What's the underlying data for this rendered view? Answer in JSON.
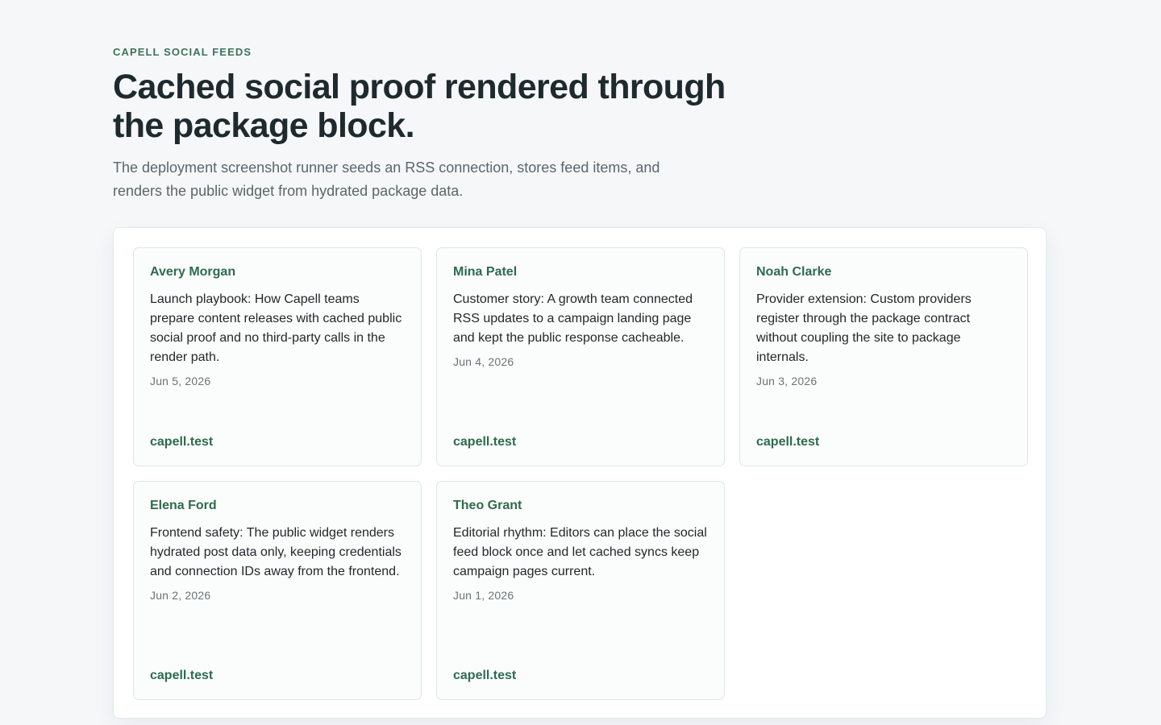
{
  "header": {
    "eyebrow": "CAPELL SOCIAL FEEDS",
    "title": "Cached social proof rendered through the package block.",
    "subtitle": "The deployment screenshot runner seeds an RSS connection, stores feed items, and renders the public widget from hydrated package data."
  },
  "posts": [
    {
      "author": "Avery Morgan",
      "text": "Launch playbook: How Capell teams prepare content releases with cached public social proof and no third-party calls in the render path.",
      "date": "Jun 5, 2026",
      "source": "capell.test"
    },
    {
      "author": "Mina Patel",
      "text": "Customer story: A growth team connected RSS updates to a campaign landing page and kept the public response cacheable.",
      "date": "Jun 4, 2026",
      "source": "capell.test"
    },
    {
      "author": "Noah Clarke",
      "text": "Provider extension: Custom providers register through the package contract without coupling the site to package internals.",
      "date": "Jun 3, 2026",
      "source": "capell.test"
    },
    {
      "author": "Elena Ford",
      "text": "Frontend safety: The public widget renders hydrated post data only, keeping credentials and connection IDs away from the frontend.",
      "date": "Jun 2, 2026",
      "source": "capell.test"
    },
    {
      "author": "Theo Grant",
      "text": "Editorial rhythm: Editors can place the social feed block once and let cached syncs keep campaign pages current.",
      "date": "Jun 1, 2026",
      "source": "capell.test"
    }
  ]
}
